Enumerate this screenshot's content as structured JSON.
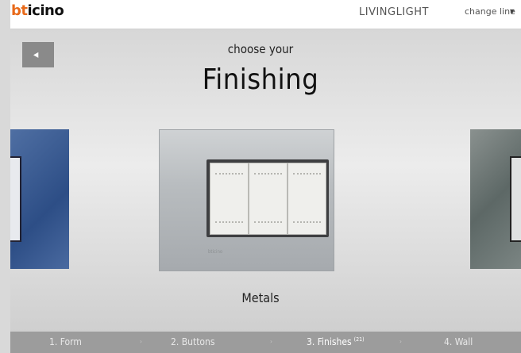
{
  "header": {
    "logo_part1": "bt",
    "logo_part2": "icino",
    "brand": "LIVINGLIGHT",
    "change_line": "change line",
    "caret": "▼"
  },
  "main": {
    "back_icon": "arrow-left-icon",
    "back_glyph": "◂",
    "subtitle": "choose your",
    "title": "Finishing",
    "plate_mark": "bticino",
    "selected_label": "Metals"
  },
  "steps": [
    {
      "label": "1. Form"
    },
    {
      "label": "2. Buttons"
    },
    {
      "label": "3. Finishes",
      "badge": "(21)"
    },
    {
      "label": "4. Wall"
    }
  ],
  "separator": "›"
}
